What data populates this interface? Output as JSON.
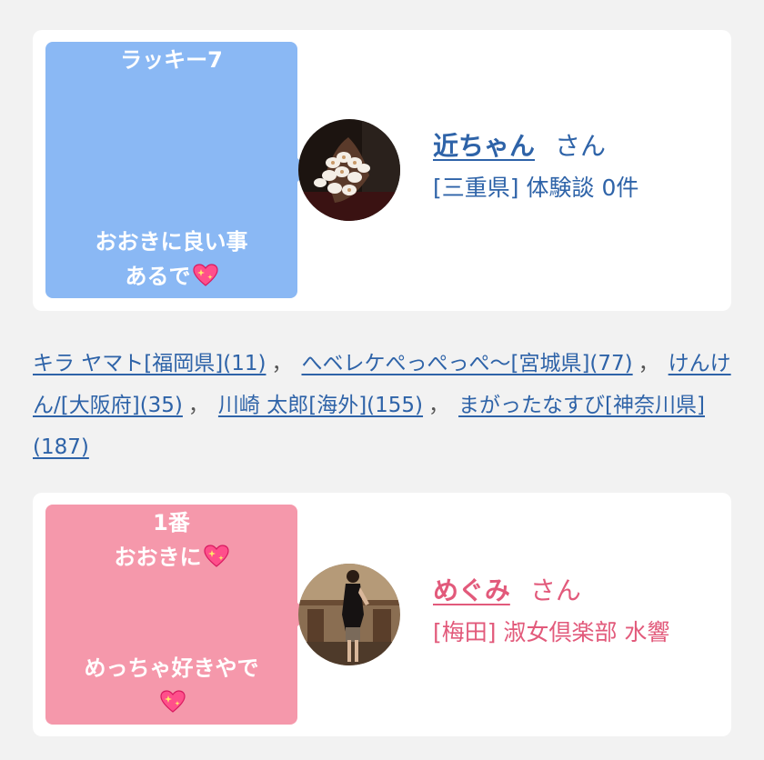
{
  "cards": [
    {
      "bubble_color": "#8ab8f4",
      "bubble_lines": [
        "ラッキー7",
        "おおきに良い事",
        "あるで"
      ],
      "name": "近ちゃん",
      "honorific": "さん",
      "prefecture": "[三重県]",
      "experience_label": "体験談",
      "experience_count": "0件",
      "name_color": "#2e63a8"
    },
    {
      "bubble_color": "#f598ab",
      "bubble_lines": [
        "1番",
        "おおきに",
        "めっちゃ好きやで"
      ],
      "name": "めぐみ",
      "honorific": "さん",
      "area": "[梅田]",
      "shop": "淑女倶楽部 水響",
      "name_color": "#e25a7b"
    }
  ],
  "links": [
    "キラ ヤマト[福岡県](11)",
    "へベレケぺっぺっぺ〜[宮城県](77)",
    "けんけん/[大阪府](35)",
    "川崎 太郎[海外](155)",
    "まがったなすび[神奈川県](187)"
  ],
  "link_separator": "，",
  "icons": {
    "sparkling_heart": "sparkling-heart-icon"
  }
}
